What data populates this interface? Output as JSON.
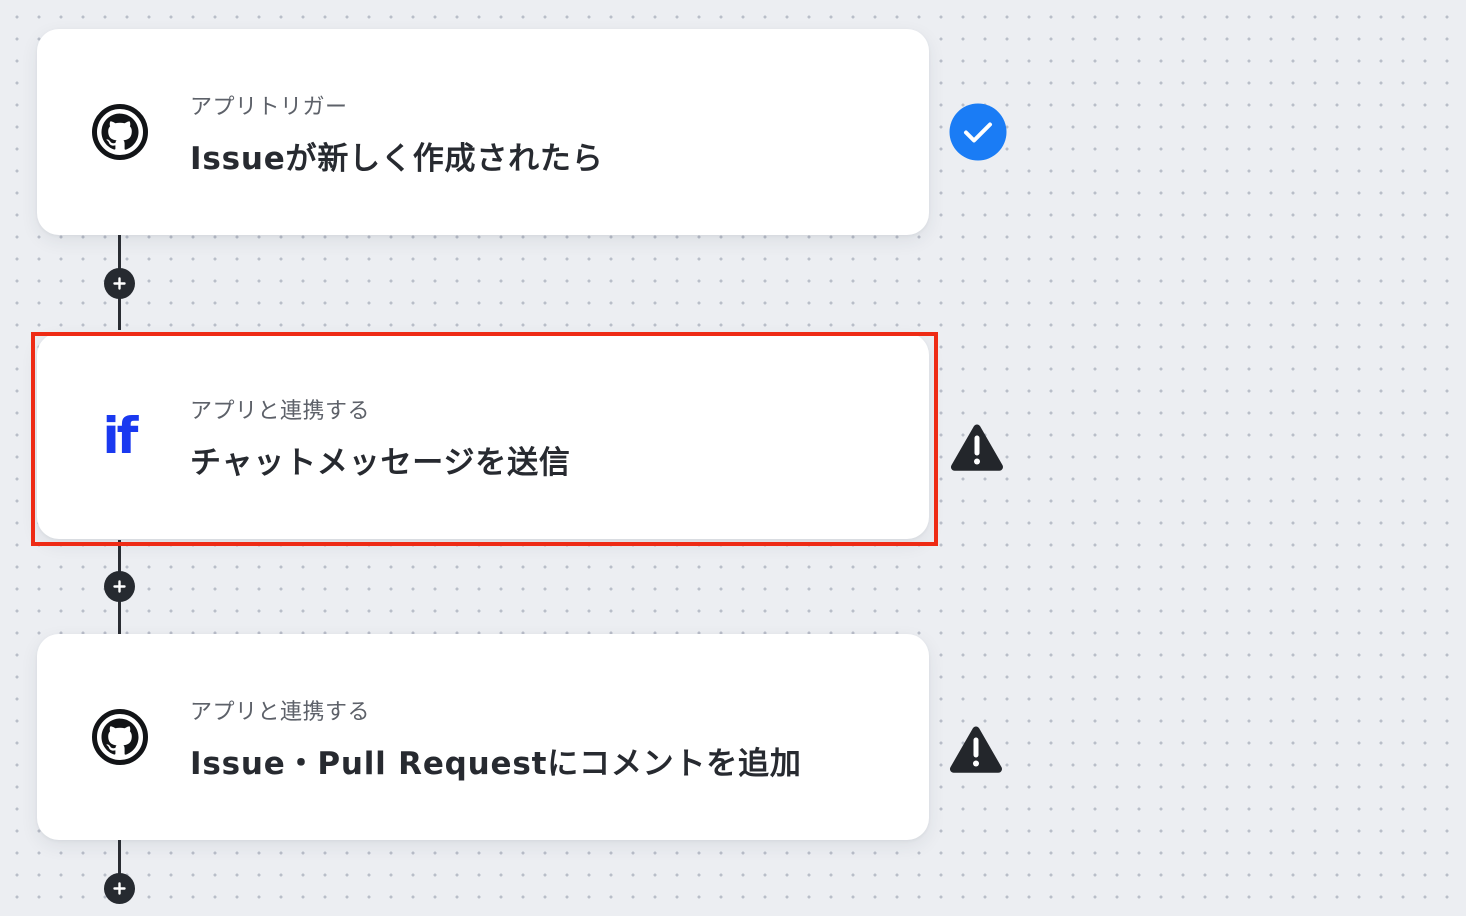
{
  "colors": {
    "canvas_background": "#eceef2",
    "card_background": "#ffffff",
    "connector": "#2a2d33",
    "success": "#1a7cf5",
    "warning": "#23262b",
    "highlight": "#ee2b15",
    "yoom_if_blue": "#1a39f0"
  },
  "flow": {
    "steps": [
      {
        "type_label": "アプリトリガー",
        "title": "Issueが新しく作成されたら",
        "app_icon": "github-icon",
        "status": "complete",
        "status_icon": "check-circle-icon",
        "highlighted": false
      },
      {
        "type_label": "アプリと連携する",
        "title": "チャットメッセージを送信",
        "app_icon": "if-app-icon",
        "app_icon_text": "if",
        "status": "warning",
        "status_icon": "warning-triangle-icon",
        "highlighted": true
      },
      {
        "type_label": "アプリと連携する",
        "title": "Issue・Pull Requestにコメントを追加",
        "app_icon": "github-icon",
        "status": "warning",
        "status_icon": "warning-triangle-icon",
        "highlighted": false
      }
    ],
    "add_step_icon": "plus-icon"
  }
}
